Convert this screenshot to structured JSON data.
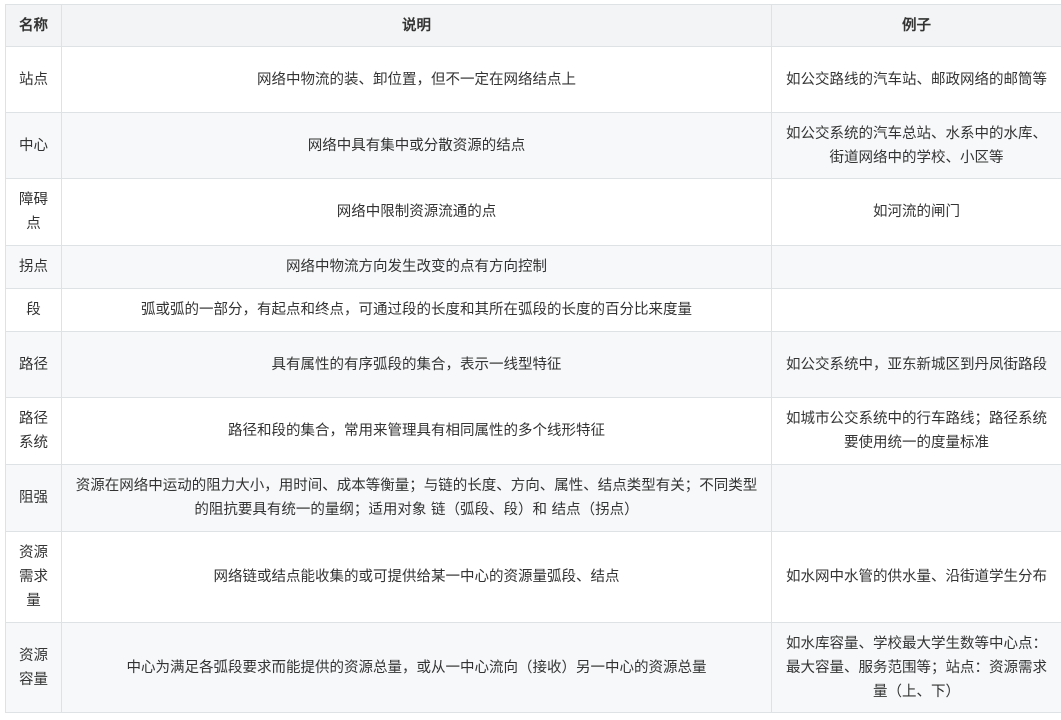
{
  "header": {
    "name": "名称",
    "desc": "说明",
    "example": "例子"
  },
  "rows": [
    {
      "name": "站点",
      "desc": "网络中物流的装、卸位置，但不一定在网络结点上",
      "example": "如公交路线的汽车站、邮政网络的邮筒等"
    },
    {
      "name": "中心",
      "desc": "网络中具有集中或分散资源的结点",
      "example": "如公交系统的汽车总站、水系中的水库、街道网络中的学校、小区等"
    },
    {
      "name": "障碍点",
      "desc": "网络中限制资源流通的点",
      "example": "如河流的闸门"
    },
    {
      "name": "拐点",
      "desc": "网络中物流方向发生改变的点有方向控制",
      "example": ""
    },
    {
      "name": "段",
      "desc": "弧或弧的一部分，有起点和终点，可通过段的长度和其所在弧段的长度的百分比来度量",
      "example": ""
    },
    {
      "name": "路径",
      "desc": "具有属性的有序弧段的集合，表示一线型特征",
      "example": "如公交系统中，亚东新城区到丹凤街路段"
    },
    {
      "name": "路径系统",
      "desc": "路径和段的集合，常用来管理具有相同属性的多个线形特征",
      "example": "如城市公交系统中的行车路线；路径系统要使用统一的度量标准"
    },
    {
      "name": "阻强",
      "desc": "资源在网络中运动的阻力大小，用时间、成本等衡量；与链的长度、方向、属性、结点类型有关；不同类型的阻抗要具有统一的量纲；适用对象 链（弧段、段）和 结点（拐点）",
      "example": ""
    },
    {
      "name": "资源需求量",
      "desc": "网络链或结点能收集的或可提供给某一中心的资源量弧段、结点",
      "example": "如水网中水管的供水量、沿街道学生分布"
    },
    {
      "name": "资源容量",
      "desc": "中心为满足各弧段要求而能提供的资源总量，或从一中心流向（接收）另一中心的资源总量",
      "example": "如水库容量、学校最大学生数等中心点：最大容量、服务范围等；站点：资源需求量（上、下）"
    }
  ]
}
